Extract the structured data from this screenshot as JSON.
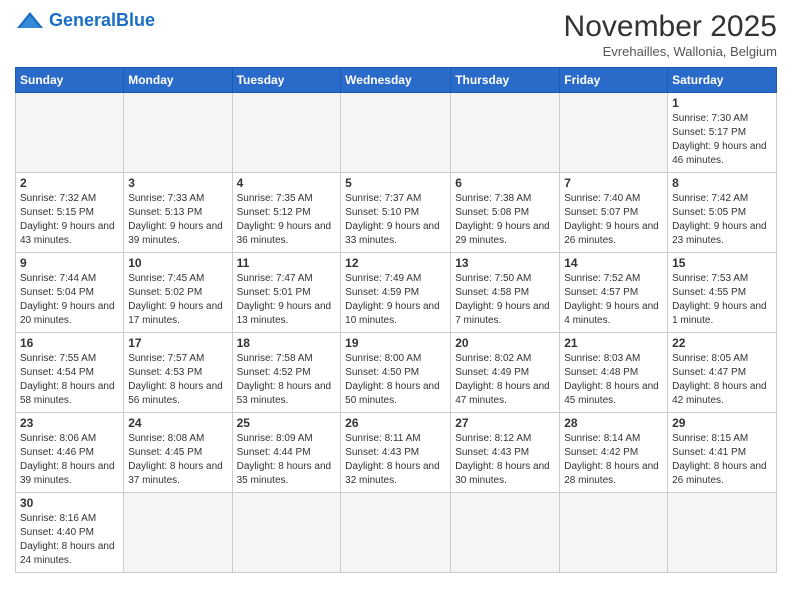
{
  "logo": {
    "general": "General",
    "blue": "Blue"
  },
  "header": {
    "month": "November 2025",
    "location": "Evrehailles, Wallonia, Belgium"
  },
  "weekdays": [
    "Sunday",
    "Monday",
    "Tuesday",
    "Wednesday",
    "Thursday",
    "Friday",
    "Saturday"
  ],
  "weeks": [
    [
      {
        "day": "",
        "empty": true
      },
      {
        "day": "",
        "empty": true
      },
      {
        "day": "",
        "empty": true
      },
      {
        "day": "",
        "empty": true
      },
      {
        "day": "",
        "empty": true
      },
      {
        "day": "",
        "empty": true
      },
      {
        "day": "1",
        "sunrise": "Sunrise: 7:30 AM",
        "sunset": "Sunset: 5:17 PM",
        "daylight": "Daylight: 9 hours and 46 minutes."
      }
    ],
    [
      {
        "day": "2",
        "sunrise": "Sunrise: 7:32 AM",
        "sunset": "Sunset: 5:15 PM",
        "daylight": "Daylight: 9 hours and 43 minutes."
      },
      {
        "day": "3",
        "sunrise": "Sunrise: 7:33 AM",
        "sunset": "Sunset: 5:13 PM",
        "daylight": "Daylight: 9 hours and 39 minutes."
      },
      {
        "day": "4",
        "sunrise": "Sunrise: 7:35 AM",
        "sunset": "Sunset: 5:12 PM",
        "daylight": "Daylight: 9 hours and 36 minutes."
      },
      {
        "day": "5",
        "sunrise": "Sunrise: 7:37 AM",
        "sunset": "Sunset: 5:10 PM",
        "daylight": "Daylight: 9 hours and 33 minutes."
      },
      {
        "day": "6",
        "sunrise": "Sunrise: 7:38 AM",
        "sunset": "Sunset: 5:08 PM",
        "daylight": "Daylight: 9 hours and 29 minutes."
      },
      {
        "day": "7",
        "sunrise": "Sunrise: 7:40 AM",
        "sunset": "Sunset: 5:07 PM",
        "daylight": "Daylight: 9 hours and 26 minutes."
      },
      {
        "day": "8",
        "sunrise": "Sunrise: 7:42 AM",
        "sunset": "Sunset: 5:05 PM",
        "daylight": "Daylight: 9 hours and 23 minutes."
      }
    ],
    [
      {
        "day": "9",
        "sunrise": "Sunrise: 7:44 AM",
        "sunset": "Sunset: 5:04 PM",
        "daylight": "Daylight: 9 hours and 20 minutes."
      },
      {
        "day": "10",
        "sunrise": "Sunrise: 7:45 AM",
        "sunset": "Sunset: 5:02 PM",
        "daylight": "Daylight: 9 hours and 17 minutes."
      },
      {
        "day": "11",
        "sunrise": "Sunrise: 7:47 AM",
        "sunset": "Sunset: 5:01 PM",
        "daylight": "Daylight: 9 hours and 13 minutes."
      },
      {
        "day": "12",
        "sunrise": "Sunrise: 7:49 AM",
        "sunset": "Sunset: 4:59 PM",
        "daylight": "Daylight: 9 hours and 10 minutes."
      },
      {
        "day": "13",
        "sunrise": "Sunrise: 7:50 AM",
        "sunset": "Sunset: 4:58 PM",
        "daylight": "Daylight: 9 hours and 7 minutes."
      },
      {
        "day": "14",
        "sunrise": "Sunrise: 7:52 AM",
        "sunset": "Sunset: 4:57 PM",
        "daylight": "Daylight: 9 hours and 4 minutes."
      },
      {
        "day": "15",
        "sunrise": "Sunrise: 7:53 AM",
        "sunset": "Sunset: 4:55 PM",
        "daylight": "Daylight: 9 hours and 1 minute."
      }
    ],
    [
      {
        "day": "16",
        "sunrise": "Sunrise: 7:55 AM",
        "sunset": "Sunset: 4:54 PM",
        "daylight": "Daylight: 8 hours and 58 minutes."
      },
      {
        "day": "17",
        "sunrise": "Sunrise: 7:57 AM",
        "sunset": "Sunset: 4:53 PM",
        "daylight": "Daylight: 8 hours and 56 minutes."
      },
      {
        "day": "18",
        "sunrise": "Sunrise: 7:58 AM",
        "sunset": "Sunset: 4:52 PM",
        "daylight": "Daylight: 8 hours and 53 minutes."
      },
      {
        "day": "19",
        "sunrise": "Sunrise: 8:00 AM",
        "sunset": "Sunset: 4:50 PM",
        "daylight": "Daylight: 8 hours and 50 minutes."
      },
      {
        "day": "20",
        "sunrise": "Sunrise: 8:02 AM",
        "sunset": "Sunset: 4:49 PM",
        "daylight": "Daylight: 8 hours and 47 minutes."
      },
      {
        "day": "21",
        "sunrise": "Sunrise: 8:03 AM",
        "sunset": "Sunset: 4:48 PM",
        "daylight": "Daylight: 8 hours and 45 minutes."
      },
      {
        "day": "22",
        "sunrise": "Sunrise: 8:05 AM",
        "sunset": "Sunset: 4:47 PM",
        "daylight": "Daylight: 8 hours and 42 minutes."
      }
    ],
    [
      {
        "day": "23",
        "sunrise": "Sunrise: 8:06 AM",
        "sunset": "Sunset: 4:46 PM",
        "daylight": "Daylight: 8 hours and 39 minutes."
      },
      {
        "day": "24",
        "sunrise": "Sunrise: 8:08 AM",
        "sunset": "Sunset: 4:45 PM",
        "daylight": "Daylight: 8 hours and 37 minutes."
      },
      {
        "day": "25",
        "sunrise": "Sunrise: 8:09 AM",
        "sunset": "Sunset: 4:44 PM",
        "daylight": "Daylight: 8 hours and 35 minutes."
      },
      {
        "day": "26",
        "sunrise": "Sunrise: 8:11 AM",
        "sunset": "Sunset: 4:43 PM",
        "daylight": "Daylight: 8 hours and 32 minutes."
      },
      {
        "day": "27",
        "sunrise": "Sunrise: 8:12 AM",
        "sunset": "Sunset: 4:43 PM",
        "daylight": "Daylight: 8 hours and 30 minutes."
      },
      {
        "day": "28",
        "sunrise": "Sunrise: 8:14 AM",
        "sunset": "Sunset: 4:42 PM",
        "daylight": "Daylight: 8 hours and 28 minutes."
      },
      {
        "day": "29",
        "sunrise": "Sunrise: 8:15 AM",
        "sunset": "Sunset: 4:41 PM",
        "daylight": "Daylight: 8 hours and 26 minutes."
      }
    ],
    [
      {
        "day": "30",
        "sunrise": "Sunrise: 8:16 AM",
        "sunset": "Sunset: 4:40 PM",
        "daylight": "Daylight: 8 hours and 24 minutes."
      },
      {
        "day": "",
        "empty": true
      },
      {
        "day": "",
        "empty": true
      },
      {
        "day": "",
        "empty": true
      },
      {
        "day": "",
        "empty": true
      },
      {
        "day": "",
        "empty": true
      },
      {
        "day": "",
        "empty": true
      }
    ]
  ]
}
